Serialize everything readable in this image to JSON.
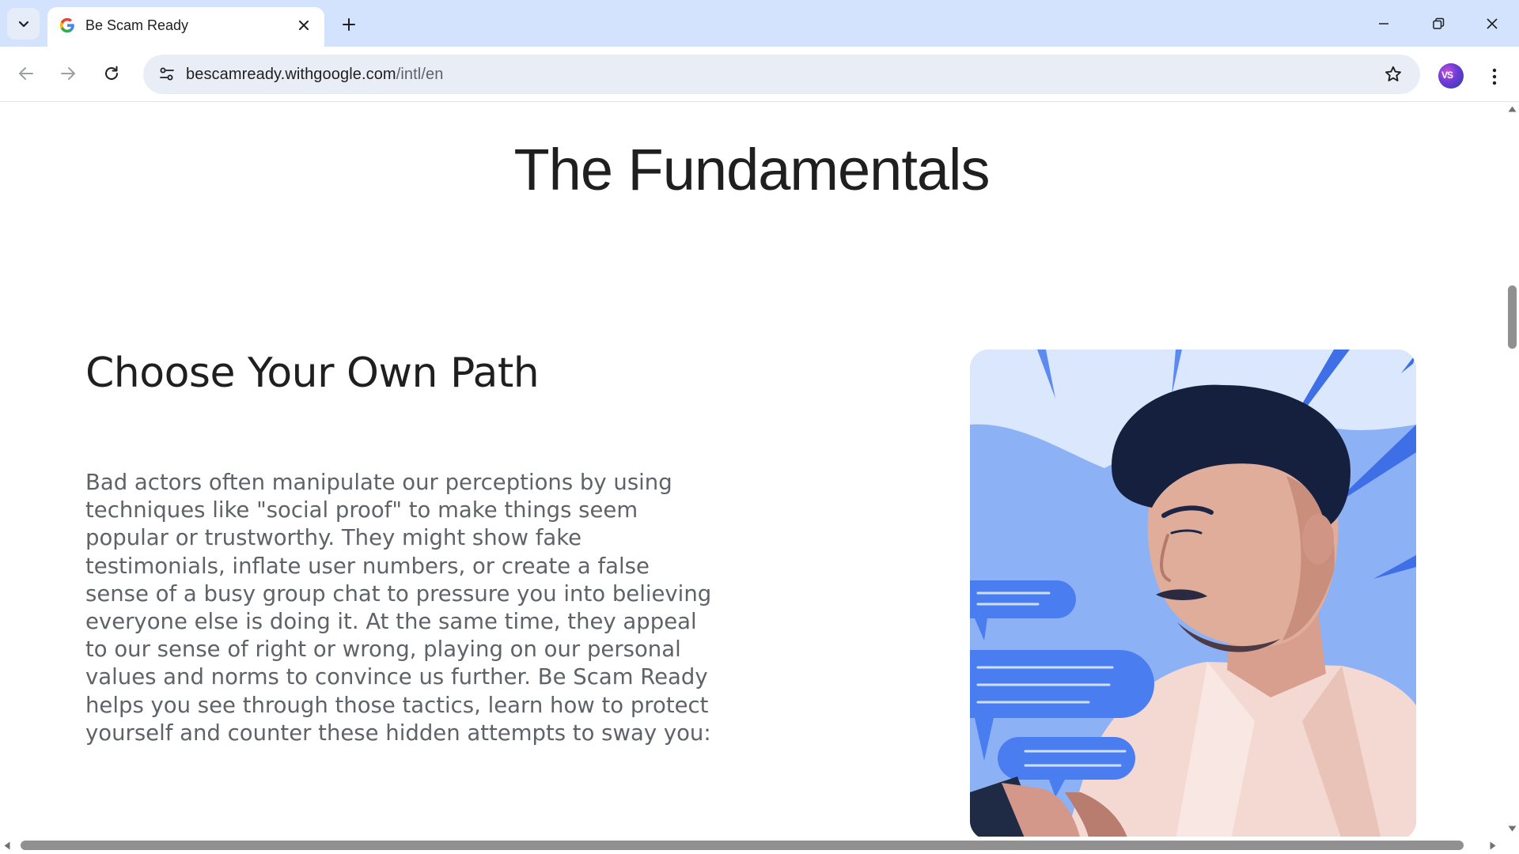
{
  "browser": {
    "tab": {
      "title": "Be Scam Ready",
      "favicon": "google-g-icon"
    },
    "url": {
      "host": "bescamready.withgoogle.com",
      "path": "/intl/en"
    },
    "avatar_initials": "VS",
    "colors": {
      "tabstrip": "#d3e3fd",
      "omnibox": "#e9eef6"
    }
  },
  "page": {
    "section_title": "The Fundamentals",
    "path_heading": "Choose Your Own Path",
    "path_body": "Bad actors often manipulate our perceptions by using techniques like \"social proof\" to make things seem popular or trustworthy. They might show fake testimonials, inflate user numbers, or create a false sense of a busy group chat to pressure you into believing everyone else is doing it. At the same time, they appeal to our sense of right or wrong, playing on our personal values and norms to convince us further. Be Scam Ready helps you see through those tactics, learn how to protect yourself and counter these hidden attempts to sway you:",
    "colors": {
      "card_bg": "#a8c3f7",
      "bubble": "#4a7ef0",
      "heading": "#1f1f1f",
      "body": "#5f6368"
    }
  }
}
